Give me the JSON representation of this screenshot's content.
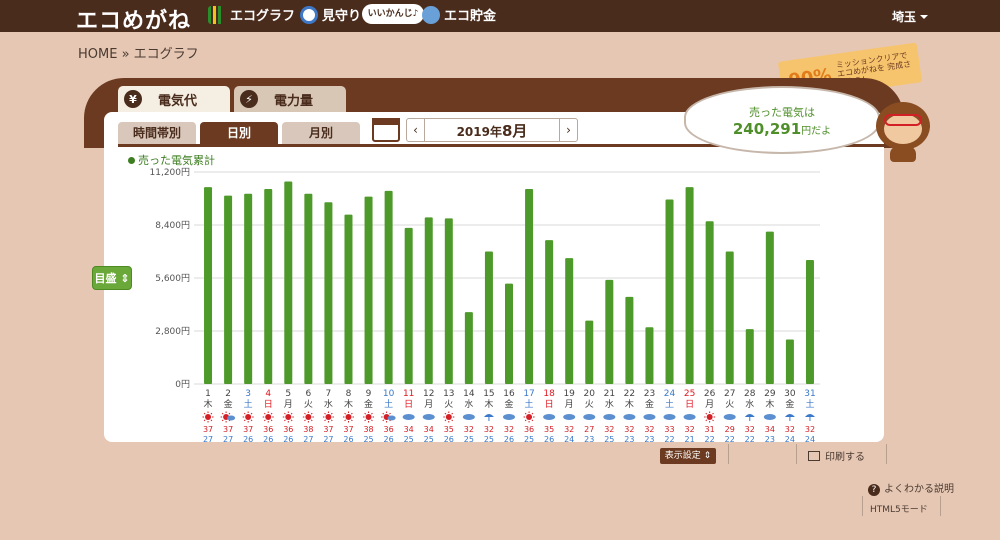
{
  "header": {
    "logo": "エコめがね",
    "nav": [
      "エコグラフ",
      "見守り",
      "エコ貯金"
    ],
    "speech": "いいかんじ♪",
    "prefecture": "埼玉"
  },
  "breadcrumb": "HOME » エコグラフ",
  "mission": {
    "percent": "90%",
    "text": "ミッションクリアで エコめがねを 完成させよう!"
  },
  "tabs": {
    "electric_cost": "電気代",
    "electric_amount": "電力量"
  },
  "subtabs": [
    "時間帯別",
    "日別",
    "月別"
  ],
  "month_selector": {
    "year": "2019年",
    "month": "8月",
    "prev": "‹",
    "next": "›"
  },
  "bubble": {
    "line1": "売った電気は",
    "amount": "240,291",
    "suffix": "円だよ"
  },
  "legend": "売った電気累計",
  "goal_button": "目盛 ⇕",
  "footer": {
    "display_settings": "表示設定 ⇕",
    "print": "印刷する",
    "help": "よくわかる説明",
    "html5": "HTML5モード",
    "help_icon": "?"
  },
  "chart_data": {
    "type": "bar",
    "ylim": [
      0,
      11200
    ],
    "yticks": [
      "11,200円",
      "8,400円",
      "5,600円",
      "2,800円",
      "0円"
    ],
    "categories": [
      "1",
      "2",
      "3",
      "4",
      "5",
      "6",
      "7",
      "8",
      "9",
      "10",
      "11",
      "12",
      "13",
      "14",
      "15",
      "16",
      "17",
      "18",
      "19",
      "20",
      "21",
      "22",
      "23",
      "24",
      "25",
      "26",
      "27",
      "28",
      "29",
      "30",
      "31"
    ],
    "weekdays": [
      "木",
      "金",
      "土",
      "日",
      "月",
      "火",
      "水",
      "木",
      "金",
      "土",
      "日",
      "月",
      "火",
      "水",
      "木",
      "金",
      "土",
      "日",
      "月",
      "火",
      "水",
      "木",
      "金",
      "土",
      "日",
      "月",
      "火",
      "水",
      "木",
      "金",
      "土"
    ],
    "values": [
      10400,
      9950,
      10050,
      10300,
      10700,
      10050,
      9600,
      8950,
      9900,
      10200,
      8250,
      8800,
      8750,
      3800,
      7000,
      5300,
      10300,
      7600,
      6650,
      3350,
      5500,
      4600,
      3000,
      9750,
      10400,
      8600,
      7000,
      2900,
      8050,
      2350,
      6550
    ],
    "weather": [
      "sunny",
      "sunny-cloudy",
      "sunny",
      "sunny",
      "sunny",
      "sunny",
      "sunny",
      "sunny",
      "sunny",
      "sunny-cloudy",
      "cloudy",
      "cloudy",
      "sunny",
      "cloudy",
      "rain",
      "cloudy",
      "sunny",
      "cloudy",
      "cloudy",
      "cloudy",
      "cloudy",
      "cloudy",
      "cloudy",
      "cloudy",
      "cloudy",
      "sunny",
      "cloudy",
      "rain",
      "cloudy",
      "rain",
      "rain"
    ],
    "high_temps": [
      "37",
      "37",
      "37",
      "36",
      "36",
      "38",
      "37",
      "37",
      "38",
      "36",
      "34",
      "34",
      "35",
      "32",
      "32",
      "32",
      "36",
      "35",
      "32",
      "27",
      "32",
      "32",
      "32",
      "33",
      "32",
      "31",
      "29",
      "32",
      "34",
      "32",
      "32"
    ],
    "low_temps": [
      "27",
      "27",
      "26",
      "26",
      "26",
      "27",
      "27",
      "26",
      "25",
      "26",
      "25",
      "25",
      "26",
      "25",
      "25",
      "26",
      "25",
      "26",
      "24",
      "23",
      "25",
      "23",
      "23",
      "22",
      "21",
      "22",
      "22",
      "22",
      "23",
      "24",
      "24"
    ],
    "colors": {
      "bar": "#4d9a2a",
      "grid": "#d9d9d9",
      "sat": "#3a79c9",
      "sun": "#e0161e",
      "weekday": "#444444"
    }
  }
}
